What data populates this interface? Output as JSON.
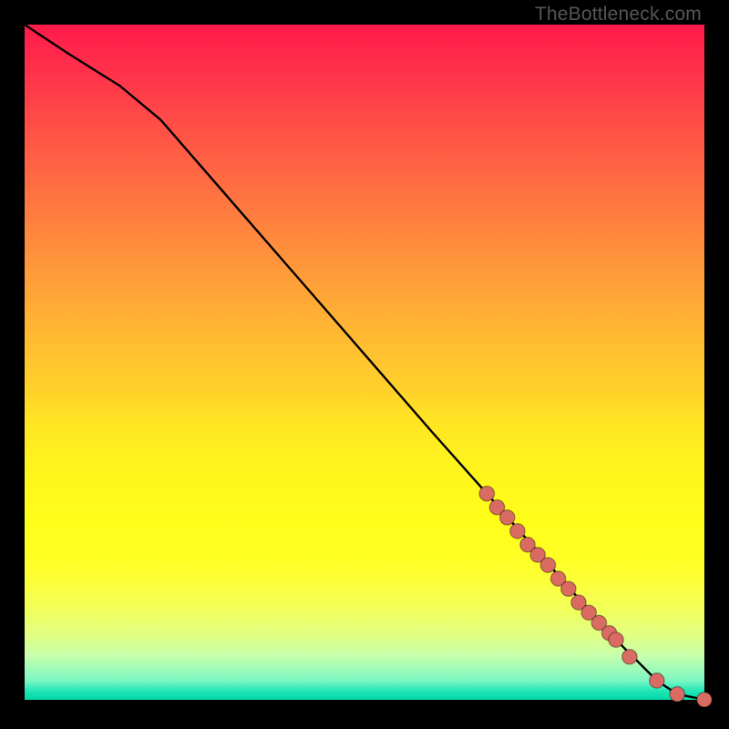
{
  "watermark": "TheBottleneck.com",
  "colors": {
    "point_fill": "#d96b63",
    "curve_stroke": "#000000"
  },
  "chart_data": {
    "type": "line",
    "title": "",
    "xlabel": "",
    "ylabel": "",
    "xlim": [
      0,
      100
    ],
    "ylim": [
      0,
      100
    ],
    "grid": false,
    "legend": false,
    "series": [
      {
        "name": "curve",
        "kind": "line",
        "x": [
          0,
          3,
          6,
          10,
          14,
          20,
          30,
          40,
          50,
          60,
          68,
          75,
          82,
          88,
          93,
          96,
          100
        ],
        "y": [
          100,
          98,
          96,
          93.5,
          91,
          86,
          74.5,
          63,
          51.5,
          40,
          31,
          23,
          15,
          8.5,
          3.5,
          1.5,
          0.7
        ]
      },
      {
        "name": "points",
        "kind": "scatter",
        "x": [
          68,
          69.5,
          71,
          72.5,
          74,
          75.5,
          77,
          78.5,
          80,
          81.5,
          83,
          84.5,
          86,
          87,
          89,
          93,
          96,
          100
        ],
        "y": [
          31,
          29,
          27.5,
          25.5,
          23.5,
          22,
          20.5,
          18.5,
          17,
          15,
          13.5,
          12,
          10.5,
          9.5,
          7,
          3.5,
          1.5,
          0.7
        ]
      }
    ]
  }
}
